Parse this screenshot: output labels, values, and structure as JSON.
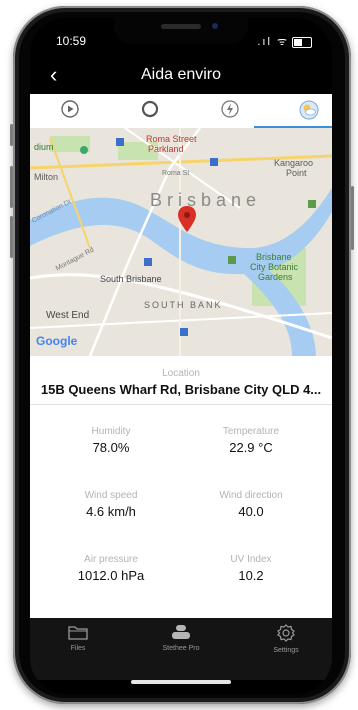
{
  "status_bar": {
    "time": "10:59",
    "signal": ".ıl ᯤ"
  },
  "header": {
    "title": "Aida enviro",
    "back_icon": "chevron-left-icon"
  },
  "tabs": [
    {
      "icon": "play-circle-icon",
      "active": false
    },
    {
      "icon": "ring-icon",
      "active": false
    },
    {
      "icon": "lightning-circle-icon",
      "active": false
    },
    {
      "icon": "weather-icon",
      "active": true
    }
  ],
  "map": {
    "labels": {
      "city": "Brisbane",
      "roma": "Roma Street",
      "parkland": "Parkland",
      "kangaroo": "Kangaroo",
      "point": "Point",
      "milton": "Milton",
      "south_brisbane": "South Brisbane",
      "south_bank": "SOUTH BANK",
      "west_end": "West End",
      "botanic1": "Brisbane",
      "botanic2": "City Botanic",
      "botanic3": "Gardens",
      "emporium": "dium",
      "google": "Google",
      "road1": "Roma St",
      "road2": "Montague Rd",
      "road3": "Coronation Dr"
    },
    "colors": {
      "river": "#a6cdf1",
      "land": "#e9e5dc",
      "park": "#c8e3b0",
      "pin": "#d93025",
      "highway": "#f6d46b"
    }
  },
  "location": {
    "label": "Location",
    "value": "15B Queens Wharf Rd, Brisbane City QLD 4..."
  },
  "readings": [
    {
      "label": "Humidity",
      "value": "78.0%"
    },
    {
      "label": "Temperature",
      "value": "22.9 °C"
    },
    {
      "label": "Wind speed",
      "value": "4.6 km/h"
    },
    {
      "label": "Wind direction",
      "value": "40.0"
    },
    {
      "label": "Air pressure",
      "value": "1012.0 hPa"
    },
    {
      "label": "UV Index",
      "value": "10.2"
    }
  ],
  "tabbar": {
    "items": [
      {
        "label": "Files",
        "icon": "folder-icon"
      },
      {
        "label": "Stethee Pro",
        "icon": "device-icon"
      },
      {
        "label": "Settings",
        "icon": "gear-icon"
      }
    ]
  }
}
